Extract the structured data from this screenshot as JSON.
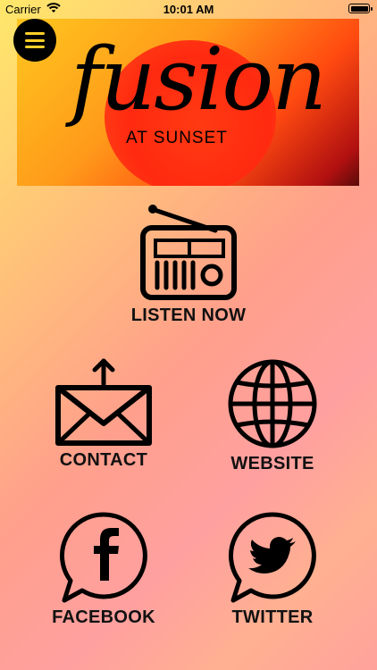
{
  "status_bar": {
    "carrier": "Carrier",
    "time": "10:01 AM",
    "battery_level": 1.0
  },
  "menu": {
    "icon": "hamburger-menu-icon"
  },
  "banner": {
    "brand": "fusion",
    "tagline": "AT SUNSET"
  },
  "tiles": [
    {
      "label": "LISTEN NOW",
      "icon": "radio-icon"
    },
    {
      "label": "CONTACT",
      "icon": "envelope-upload-icon"
    },
    {
      "label": "WEBSITE",
      "icon": "globe-icon"
    },
    {
      "label": "FACEBOOK",
      "icon": "facebook-icon"
    },
    {
      "label": "TWITTER",
      "icon": "twitter-icon"
    }
  ],
  "colors": {
    "banner_sun": "#ff2a10",
    "menu_bars": "#ffcf28",
    "icon_stroke": "#000000"
  }
}
